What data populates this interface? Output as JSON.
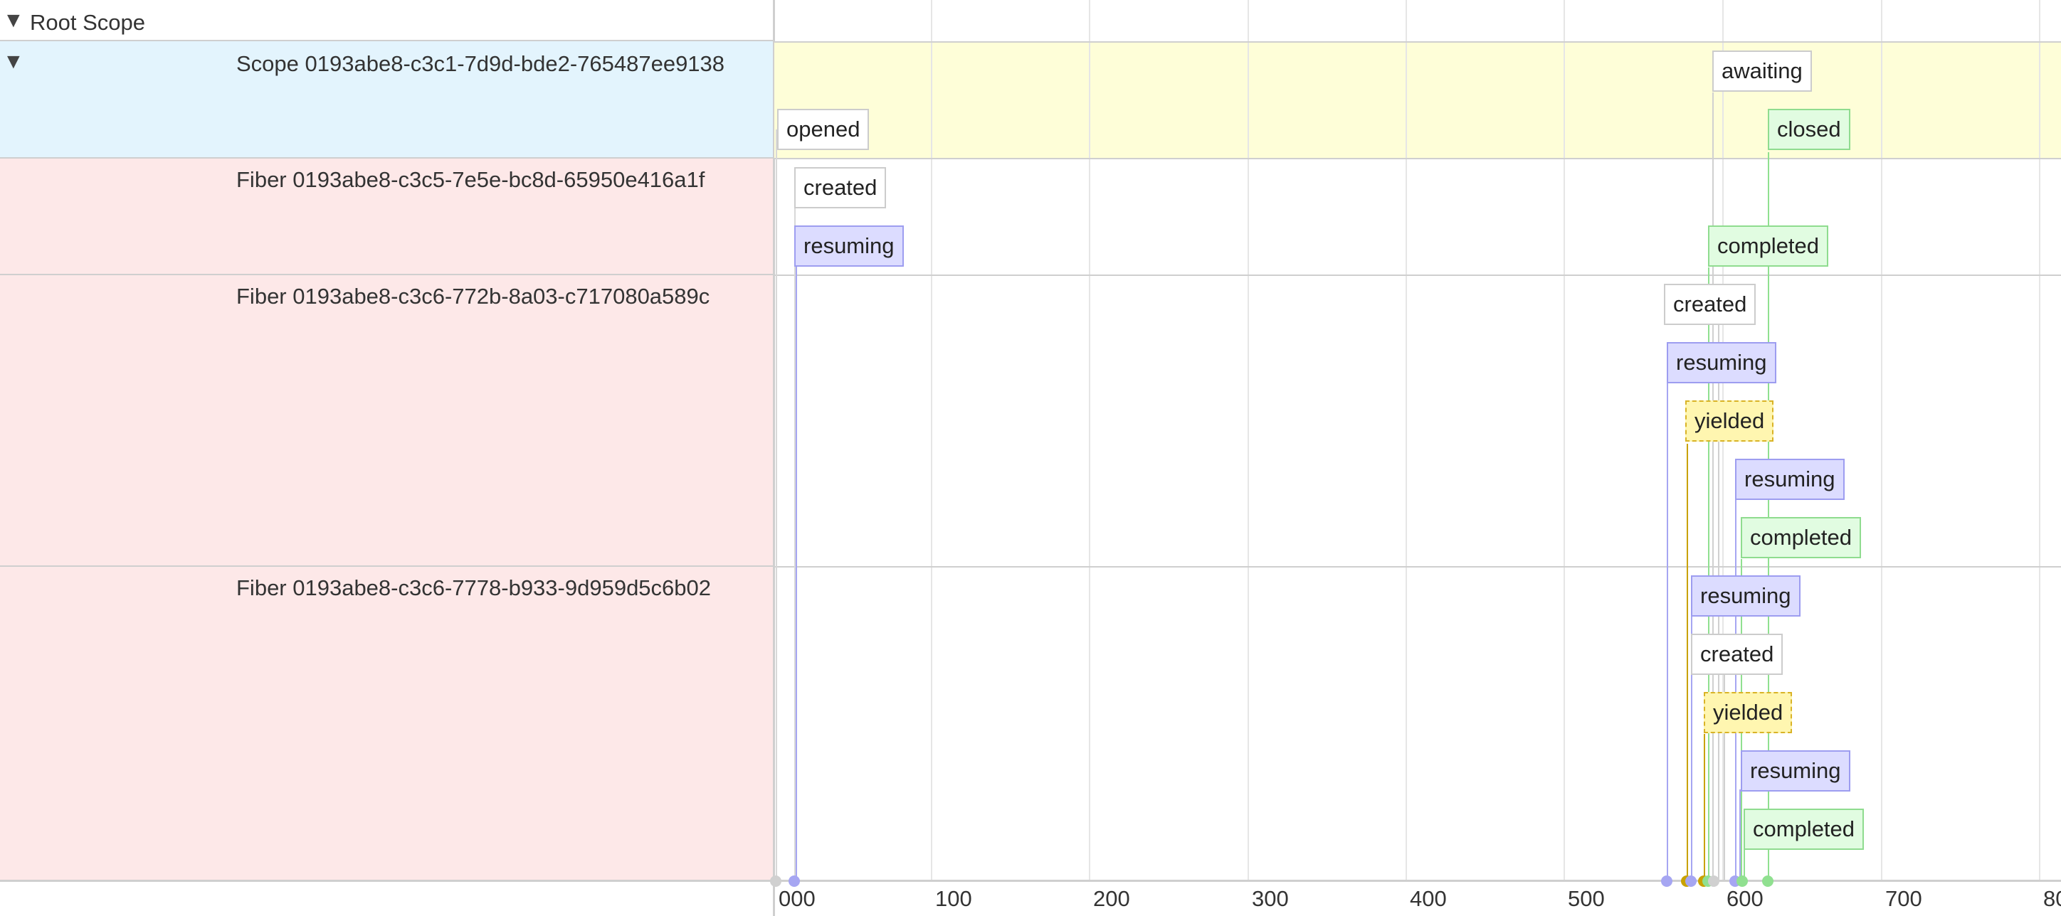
{
  "root": {
    "label": "Root Scope",
    "caret": "▼"
  },
  "rows": [
    {
      "id": "scope",
      "caret": "▼",
      "label": "Scope 0193abe8-c3c1-7d9d-bde2-765487ee9138"
    },
    {
      "id": "fiber1",
      "label": "Fiber 0193abe8-c3c5-7e5e-bc8d-65950e416a1f"
    },
    {
      "id": "fiber2",
      "label": "Fiber 0193abe8-c3c6-772b-8a03-c717080a589c"
    },
    {
      "id": "fiber3",
      "label": "Fiber 0193abe8-c3c6-7778-b933-9d959d5c6b02"
    }
  ],
  "axis": {
    "ticks": [
      "000",
      "100",
      "200",
      "300",
      "400",
      "500",
      "600",
      "700",
      "80"
    ]
  },
  "events": {
    "scope_opened": "opened",
    "scope_awaiting": "awaiting",
    "scope_closed": "closed",
    "f1_created": "created",
    "f1_resuming": "resuming",
    "f1_completed": "completed",
    "f2_created": "created",
    "f2_resuming1": "resuming",
    "f2_yielded": "yielded",
    "f2_resuming2": "resuming",
    "f2_completed": "completed",
    "f3_resuming1": "resuming",
    "f3_created": "created",
    "f3_yielded": "yielded",
    "f3_resuming2": "resuming",
    "f3_completed": "completed"
  },
  "colors": {
    "scope_row": "#e3f4fd",
    "fiber_row": "#fde8e8",
    "scope_lane": "#fefed8",
    "resuming": "#dcdcff",
    "completed": "#e1fce1",
    "yielded": "#fff6b0",
    "neutral": "#ffffff"
  }
}
